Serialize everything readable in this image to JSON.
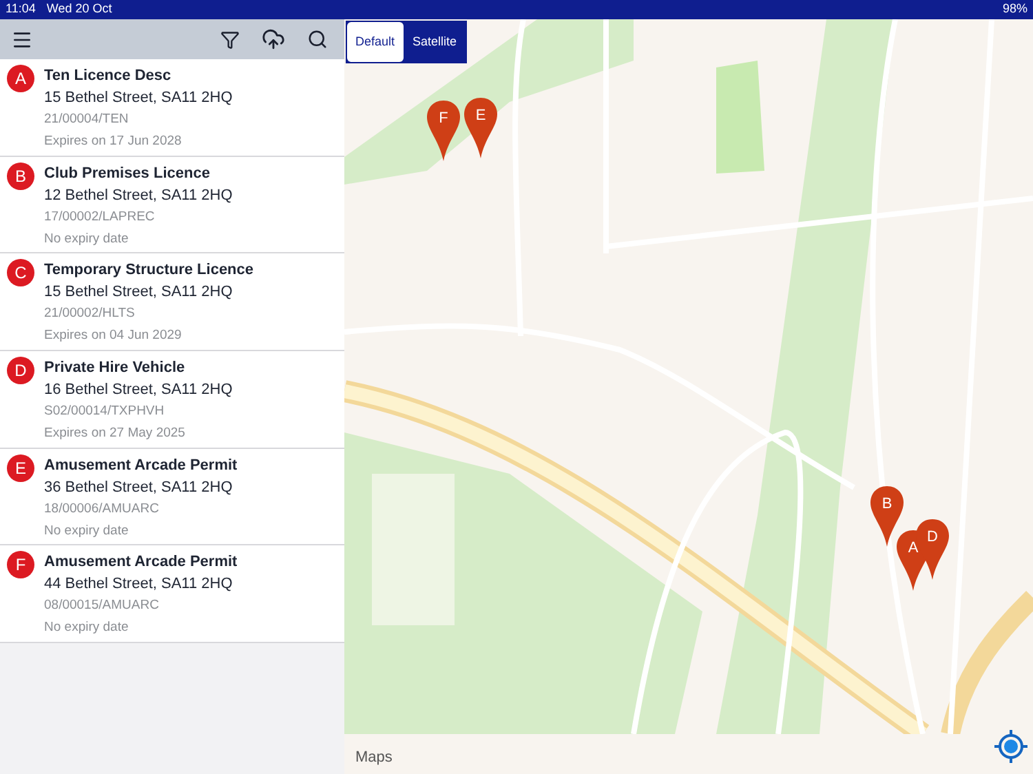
{
  "status_bar": {
    "time": "11:04",
    "date": "Wed 20 Oct",
    "battery": "98%"
  },
  "licences": [
    {
      "marker": "A",
      "title": "Ten Licence Desc",
      "address": "15 Bethel Street, SA11 2HQ",
      "reference": "21/00004/TEN",
      "expiry": "Expires on 17 Jun 2028"
    },
    {
      "marker": "B",
      "title": "Club Premises Licence",
      "address": "12 Bethel Street, SA11 2HQ",
      "reference": "17/00002/LAPREC",
      "expiry": "No expiry date"
    },
    {
      "marker": "C",
      "title": "Temporary Structure Licence",
      "address": "15 Bethel Street, SA11 2HQ",
      "reference": "21/00002/HLTS",
      "expiry": "Expires on 04 Jun 2029"
    },
    {
      "marker": "D",
      "title": "Private Hire Vehicle",
      "address": "16 Bethel Street, SA11 2HQ",
      "reference": "S02/00014/TXPHVH",
      "expiry": "Expires on 27 May 2025"
    },
    {
      "marker": "E",
      "title": "Amusement Arcade Permit",
      "address": "36 Bethel Street, SA11 2HQ",
      "reference": "18/00006/AMUARC",
      "expiry": "No expiry date"
    },
    {
      "marker": "F",
      "title": "Amusement Arcade Permit",
      "address": "44 Bethel Street, SA11 2HQ",
      "reference": "08/00015/AMUARC",
      "expiry": "No expiry date"
    }
  ],
  "map_types": [
    {
      "label": "Default",
      "selected": true
    },
    {
      "label": "Satellite",
      "selected": false
    }
  ],
  "map_pins": [
    "F",
    "E",
    "B",
    "A",
    "D"
  ],
  "attribution": "Maps"
}
